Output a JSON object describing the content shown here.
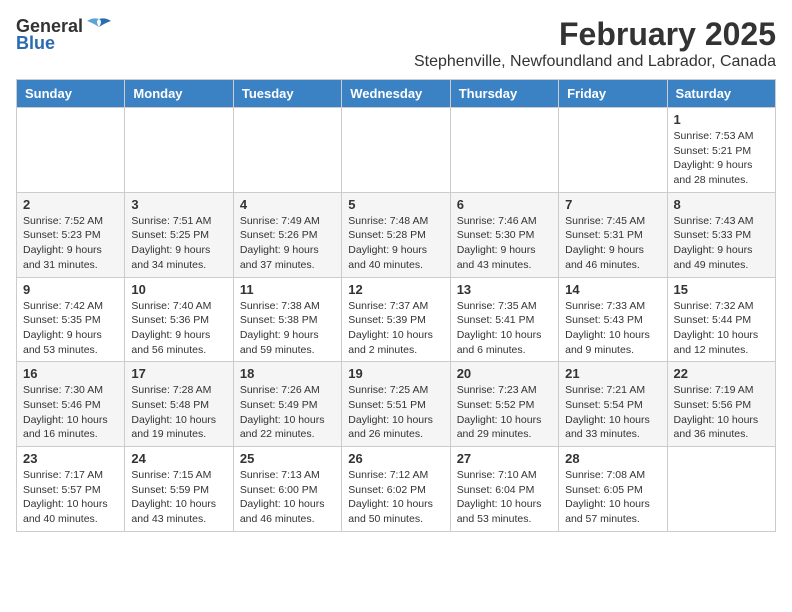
{
  "logo": {
    "general": "General",
    "blue": "Blue"
  },
  "title": "February 2025",
  "location": "Stephenville, Newfoundland and Labrador, Canada",
  "days_of_week": [
    "Sunday",
    "Monday",
    "Tuesday",
    "Wednesday",
    "Thursday",
    "Friday",
    "Saturday"
  ],
  "weeks": [
    {
      "shade": "row-white",
      "days": [
        {
          "num": "",
          "info": ""
        },
        {
          "num": "",
          "info": ""
        },
        {
          "num": "",
          "info": ""
        },
        {
          "num": "",
          "info": ""
        },
        {
          "num": "",
          "info": ""
        },
        {
          "num": "",
          "info": ""
        },
        {
          "num": "1",
          "info": "Sunrise: 7:53 AM\nSunset: 5:21 PM\nDaylight: 9 hours and 28 minutes."
        }
      ]
    },
    {
      "shade": "row-shaded",
      "days": [
        {
          "num": "2",
          "info": "Sunrise: 7:52 AM\nSunset: 5:23 PM\nDaylight: 9 hours and 31 minutes."
        },
        {
          "num": "3",
          "info": "Sunrise: 7:51 AM\nSunset: 5:25 PM\nDaylight: 9 hours and 34 minutes."
        },
        {
          "num": "4",
          "info": "Sunrise: 7:49 AM\nSunset: 5:26 PM\nDaylight: 9 hours and 37 minutes."
        },
        {
          "num": "5",
          "info": "Sunrise: 7:48 AM\nSunset: 5:28 PM\nDaylight: 9 hours and 40 minutes."
        },
        {
          "num": "6",
          "info": "Sunrise: 7:46 AM\nSunset: 5:30 PM\nDaylight: 9 hours and 43 minutes."
        },
        {
          "num": "7",
          "info": "Sunrise: 7:45 AM\nSunset: 5:31 PM\nDaylight: 9 hours and 46 minutes."
        },
        {
          "num": "8",
          "info": "Sunrise: 7:43 AM\nSunset: 5:33 PM\nDaylight: 9 hours and 49 minutes."
        }
      ]
    },
    {
      "shade": "row-white",
      "days": [
        {
          "num": "9",
          "info": "Sunrise: 7:42 AM\nSunset: 5:35 PM\nDaylight: 9 hours and 53 minutes."
        },
        {
          "num": "10",
          "info": "Sunrise: 7:40 AM\nSunset: 5:36 PM\nDaylight: 9 hours and 56 minutes."
        },
        {
          "num": "11",
          "info": "Sunrise: 7:38 AM\nSunset: 5:38 PM\nDaylight: 9 hours and 59 minutes."
        },
        {
          "num": "12",
          "info": "Sunrise: 7:37 AM\nSunset: 5:39 PM\nDaylight: 10 hours and 2 minutes."
        },
        {
          "num": "13",
          "info": "Sunrise: 7:35 AM\nSunset: 5:41 PM\nDaylight: 10 hours and 6 minutes."
        },
        {
          "num": "14",
          "info": "Sunrise: 7:33 AM\nSunset: 5:43 PM\nDaylight: 10 hours and 9 minutes."
        },
        {
          "num": "15",
          "info": "Sunrise: 7:32 AM\nSunset: 5:44 PM\nDaylight: 10 hours and 12 minutes."
        }
      ]
    },
    {
      "shade": "row-shaded",
      "days": [
        {
          "num": "16",
          "info": "Sunrise: 7:30 AM\nSunset: 5:46 PM\nDaylight: 10 hours and 16 minutes."
        },
        {
          "num": "17",
          "info": "Sunrise: 7:28 AM\nSunset: 5:48 PM\nDaylight: 10 hours and 19 minutes."
        },
        {
          "num": "18",
          "info": "Sunrise: 7:26 AM\nSunset: 5:49 PM\nDaylight: 10 hours and 22 minutes."
        },
        {
          "num": "19",
          "info": "Sunrise: 7:25 AM\nSunset: 5:51 PM\nDaylight: 10 hours and 26 minutes."
        },
        {
          "num": "20",
          "info": "Sunrise: 7:23 AM\nSunset: 5:52 PM\nDaylight: 10 hours and 29 minutes."
        },
        {
          "num": "21",
          "info": "Sunrise: 7:21 AM\nSunset: 5:54 PM\nDaylight: 10 hours and 33 minutes."
        },
        {
          "num": "22",
          "info": "Sunrise: 7:19 AM\nSunset: 5:56 PM\nDaylight: 10 hours and 36 minutes."
        }
      ]
    },
    {
      "shade": "row-white",
      "days": [
        {
          "num": "23",
          "info": "Sunrise: 7:17 AM\nSunset: 5:57 PM\nDaylight: 10 hours and 40 minutes."
        },
        {
          "num": "24",
          "info": "Sunrise: 7:15 AM\nSunset: 5:59 PM\nDaylight: 10 hours and 43 minutes."
        },
        {
          "num": "25",
          "info": "Sunrise: 7:13 AM\nSunset: 6:00 PM\nDaylight: 10 hours and 46 minutes."
        },
        {
          "num": "26",
          "info": "Sunrise: 7:12 AM\nSunset: 6:02 PM\nDaylight: 10 hours and 50 minutes."
        },
        {
          "num": "27",
          "info": "Sunrise: 7:10 AM\nSunset: 6:04 PM\nDaylight: 10 hours and 53 minutes."
        },
        {
          "num": "28",
          "info": "Sunrise: 7:08 AM\nSunset: 6:05 PM\nDaylight: 10 hours and 57 minutes."
        },
        {
          "num": "",
          "info": ""
        }
      ]
    }
  ]
}
